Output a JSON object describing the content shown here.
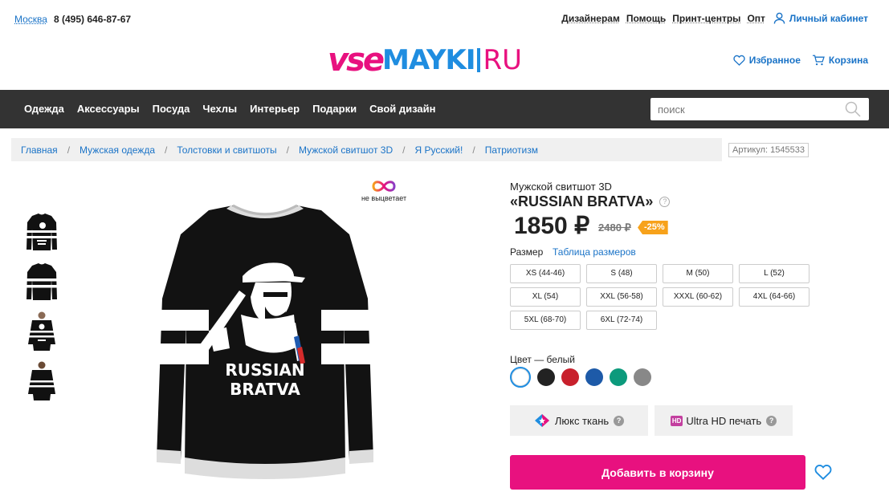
{
  "top": {
    "city": "Москва",
    "phone": "8 (495) 646-87-67",
    "links": [
      "Дизайнерам",
      "Помощь",
      "Принт-центры",
      "Опт"
    ],
    "cabinet": "Личный кабинет"
  },
  "logo": {
    "part1": "vse",
    "part2": "MAYKI",
    "part3": "RU"
  },
  "header": {
    "favorites": "Избранное",
    "cart": "Корзина"
  },
  "nav": {
    "items": [
      "Одежда",
      "Аксессуары",
      "Посуда",
      "Чехлы",
      "Интерьер",
      "Подарки",
      "Свой дизайн"
    ],
    "search_placeholder": "поиск"
  },
  "breadcrumb": [
    "Главная",
    "Мужская одежда",
    "Толстовки и свитшоты",
    "Мужской свитшот 3D",
    "Я Русский!",
    "Патриотизм"
  ],
  "article": "Артикул: 1545533",
  "badge": {
    "text": "не выцветает",
    "icon": "infinity-icon"
  },
  "print": {
    "line1": "RUSSIAN",
    "line2": "BRATVA"
  },
  "product": {
    "type": "Мужской свитшот 3D",
    "name": "«RUSSIAN BRATVA»",
    "price": "1850 ₽",
    "old_price": "2480 ₽",
    "discount": "-25%",
    "size_label": "Размер",
    "size_table": "Таблица размеров",
    "sizes": [
      "XS (44-46)",
      "S (48)",
      "M (50)",
      "L (52)",
      "XL (54)",
      "XXL (56-58)",
      "XXXL (60-62)",
      "4XL (64-66)",
      "5XL (68-70)",
      "6XL (72-74)"
    ],
    "color_label": "Цвет — белый",
    "colors": [
      "#ffffff",
      "#222222",
      "#c8202c",
      "#1d5aa8",
      "#0c9a7c",
      "#888888"
    ],
    "selected_color": 0,
    "feature1": "Люкс ткань",
    "feature2": "Ultra HD печать",
    "hd_badge": "HD",
    "help_mark": "?",
    "add_to_cart": "Добавить в корзину"
  },
  "colors": {
    "accent": "#e8117f",
    "link": "#1a73c7",
    "nav_bg": "#333333",
    "discount": "#f7a21b"
  }
}
